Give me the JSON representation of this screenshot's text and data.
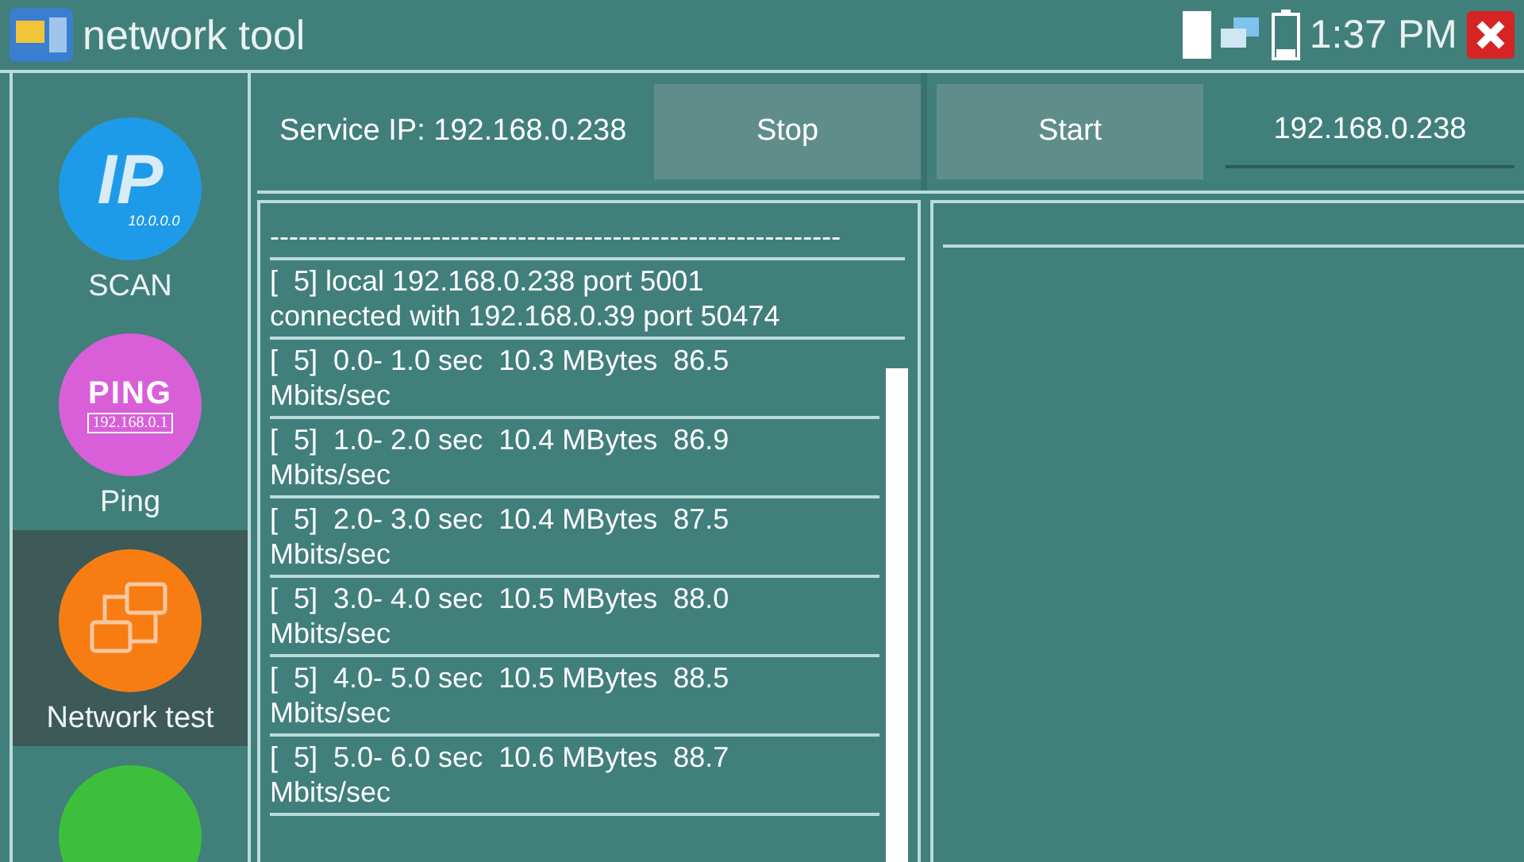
{
  "window": {
    "title": "network tool",
    "time": "1:37 PM"
  },
  "sidebar": {
    "items": [
      {
        "kind": "ip",
        "label": "SCAN",
        "icon_text": "IP",
        "icon_subtext": "10.0.0.0",
        "color": "#1e9be8",
        "selected": false
      },
      {
        "kind": "ping",
        "label": "Ping",
        "icon_text": "PING",
        "icon_subtext": "192.168.0.1",
        "color": "#d95fd9",
        "selected": false
      },
      {
        "kind": "network",
        "label": "Network test",
        "color": "#f77d12",
        "selected": true
      },
      {
        "kind": "plain",
        "color": "#3cc03c",
        "selected": false
      }
    ]
  },
  "server": {
    "label": "Service IP: 192.168.0.238",
    "button": "Stop"
  },
  "client": {
    "button": "Start",
    "ip": "192.168.0.238"
  },
  "log": [
    "------------------------------------------------------------",
    "[  5] local 192.168.0.238 port 5001 connected with 192.168.0.39 port 50474",
    "[  5]  0.0- 1.0 sec  10.3 MBytes  86.5 Mbits/sec",
    "[  5]  1.0- 2.0 sec  10.4 MBytes  86.9 Mbits/sec",
    "[  5]  2.0- 3.0 sec  10.4 MBytes  87.5 Mbits/sec",
    "[  5]  3.0- 4.0 sec  10.5 MBytes  88.0 Mbits/sec",
    "[  5]  4.0- 5.0 sec  10.5 MBytes  88.5 Mbits/sec",
    "[  5]  5.0- 6.0 sec  10.6 MBytes  88.7 Mbits/sec"
  ]
}
